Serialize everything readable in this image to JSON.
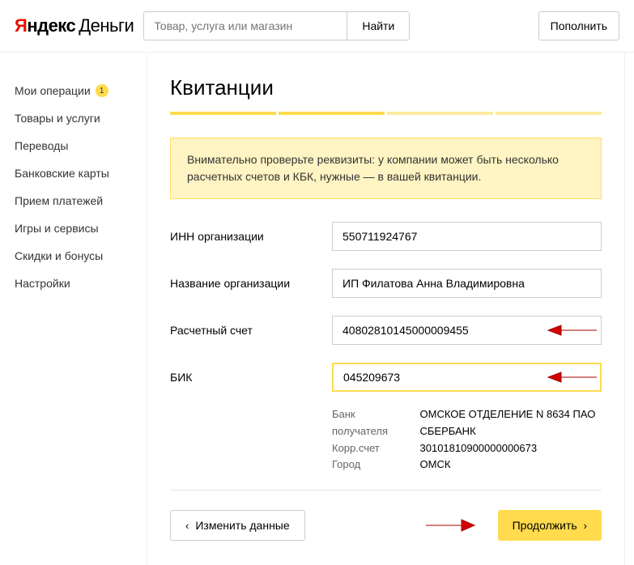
{
  "header": {
    "logo_y": "Я",
    "logo_andex": "ндекс",
    "logo_money": "Деньги",
    "search_placeholder": "Товар, услуга или магазин",
    "search_button": "Найти",
    "topup_button": "Пополнить"
  },
  "sidebar": {
    "items": [
      {
        "label": "Мои операции",
        "badge": "1"
      },
      {
        "label": "Товары и услуги"
      },
      {
        "label": "Переводы"
      },
      {
        "label": "Банковские карты"
      },
      {
        "label": "Прием платежей"
      },
      {
        "label": "Игры и сервисы"
      },
      {
        "label": "Скидки и бонусы"
      },
      {
        "label": "Настройки"
      }
    ]
  },
  "main": {
    "title": "Квитанции",
    "notice": "Внимательно проверьте реквизиты: у компании может быть несколько расчетных счетов и КБК, нужные — в вашей квитанции.",
    "fields": {
      "inn_label": "ИНН организации",
      "inn_value": "550711924767",
      "name_label": "Название организации",
      "name_value": "ИП Филатова Анна Владимировна",
      "account_label": "Расчетный счет",
      "account_value": "40802810145000009455",
      "bik_label": "БИК",
      "bik_value": "045209673"
    },
    "bank": {
      "bank_label": "Банк получателя",
      "bank_value": "ОМСКОЕ ОТДЕЛЕНИЕ N 8634 ПАО СБЕРБАНК",
      "corr_label": "Корр.счет",
      "corr_value": "30101810900000000673",
      "city_label": "Город",
      "city_value": "ОМСК"
    },
    "actions": {
      "back": "Изменить данные",
      "continue": "Продолжить"
    }
  }
}
